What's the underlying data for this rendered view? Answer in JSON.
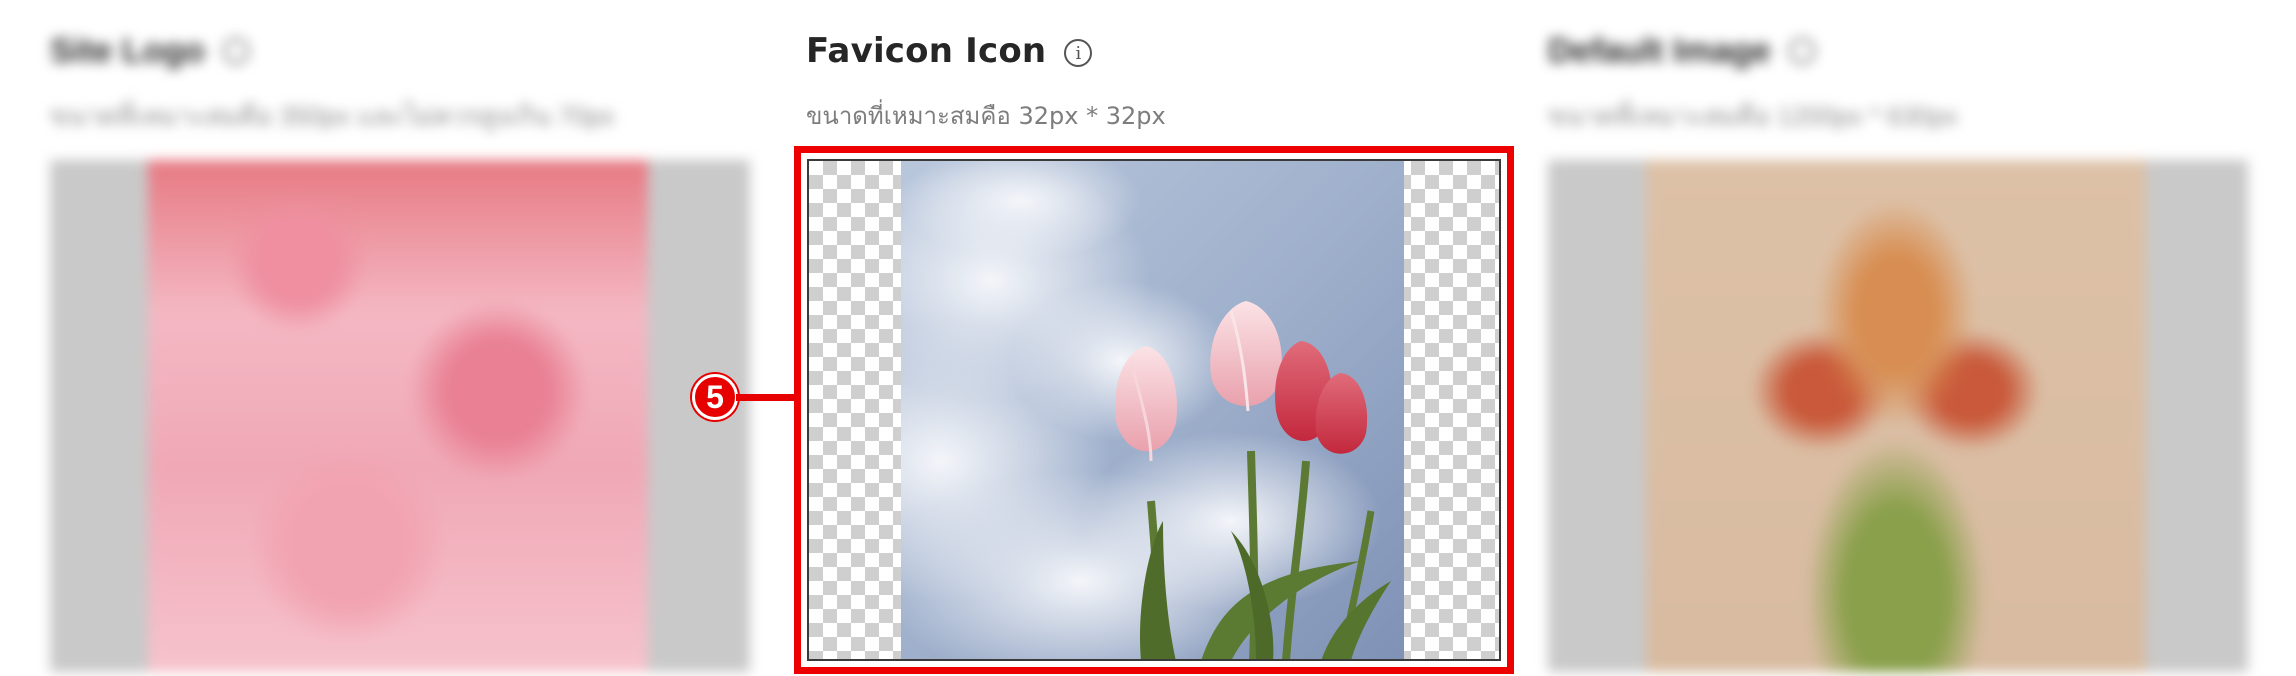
{
  "left_panel": {
    "title": "Site Logo",
    "subtitle": "ขนาดที่เหมาะสมคือ 350px และไม่ควรสูงเกิน 70px"
  },
  "center_panel": {
    "title": "Favicon Icon",
    "info_glyph": "i",
    "subtitle": "ขนาดที่เหมาะสมคือ 32px * 32px"
  },
  "right_panel": {
    "title": "Default Image",
    "subtitle": "ขนาดที่เหมาะสมคือ 1200px * 630px"
  },
  "callout": {
    "number": "5",
    "color": "#e60000"
  },
  "colors": {
    "highlight_border": "#ee0000",
    "title_text": "#262626",
    "subtitle_text": "#7d7d7d"
  }
}
